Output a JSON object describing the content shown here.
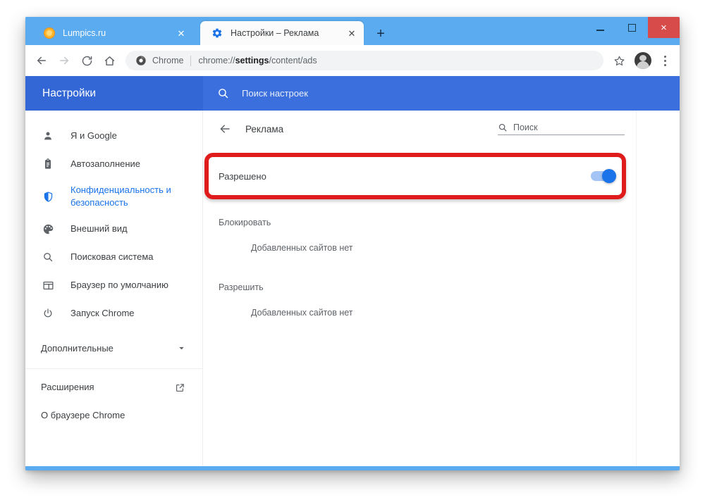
{
  "window": {
    "controls": {
      "minimize": "minimize-button",
      "maximize": "maximize-button",
      "close": "×"
    }
  },
  "tabs": [
    {
      "title": "Lumpics.ru",
      "favicon": "orange-circle-favicon",
      "active": false,
      "close": "✕"
    },
    {
      "title": "Настройки – Реклама",
      "favicon": "gear-favicon",
      "active": true,
      "close": "✕"
    }
  ],
  "new_tab_label": "+",
  "toolbar": {
    "back": "←",
    "forward": "→",
    "reload": "⟳",
    "home": "⌂",
    "omnibox": {
      "scheme_label": "Chrome",
      "url_prefix": "chrome://",
      "url_bold": "settings",
      "url_suffix": "/content/ads",
      "full_url": "chrome://settings/content/ads"
    },
    "star": "☆",
    "menu": "chrome-menu"
  },
  "settings": {
    "brand": "Настройки",
    "search_placeholder": "Поиск настроек",
    "accent_color": "#3367d6",
    "sidebar": {
      "items": [
        {
          "label": "Я и Google",
          "icon": "person-icon",
          "active": false
        },
        {
          "label": "Автозаполнение",
          "icon": "clipboard-icon",
          "active": false
        },
        {
          "label": "Конфиденциальность и безопасность",
          "icon": "shield-icon",
          "active": true
        },
        {
          "label": "Внешний вид",
          "icon": "palette-icon",
          "active": false
        },
        {
          "label": "Поисковая система",
          "icon": "search-icon",
          "active": false
        },
        {
          "label": "Браузер по умолчанию",
          "icon": "browser-window-icon",
          "active": false
        },
        {
          "label": "Запуск Chrome",
          "icon": "power-icon",
          "active": false
        }
      ],
      "advanced": {
        "label": "Дополнительные",
        "chevron": "▾"
      },
      "footer": [
        {
          "label": "Расширения",
          "icon": "external-link-icon"
        },
        {
          "label": "О браузере Chrome",
          "icon": ""
        }
      ]
    },
    "content": {
      "back_arrow": "←",
      "title": "Реклама",
      "search_placeholder": "Поиск",
      "toggle": {
        "label": "Разрешено",
        "state": "on",
        "highlight_color": "#e01b1b",
        "accent_color": "#1a73e8"
      },
      "sections": [
        {
          "heading": "Блокировать",
          "empty_text": "Добавленных сайтов нет"
        },
        {
          "heading": "Разрешить",
          "empty_text": "Добавленных сайтов нет"
        }
      ]
    }
  }
}
